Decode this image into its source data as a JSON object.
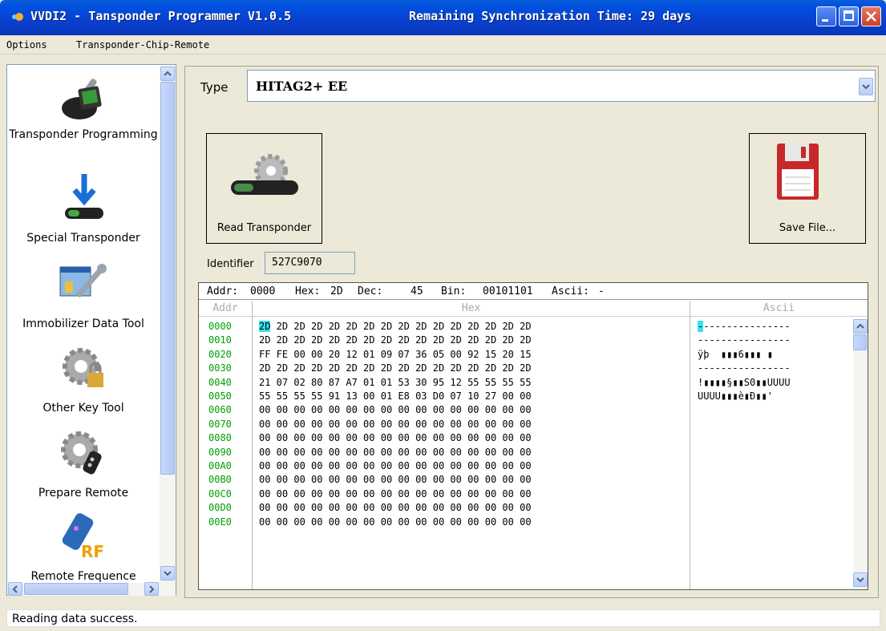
{
  "window": {
    "title": "VVDI2 - Tansponder Programmer V1.0.5",
    "sync": "Remaining Synchronization Time: 29 days"
  },
  "menu": [
    "Options",
    "Transponder-Chip-Remote"
  ],
  "sidebar": {
    "items": [
      {
        "label": "Transponder Programming",
        "icon": "key-reader-icon"
      },
      {
        "label": "Special Transponder",
        "icon": "download-arrow-icon"
      },
      {
        "label": "Immobilizer Data Tool",
        "icon": "wrench-window-icon"
      },
      {
        "label": "Other Key Tool",
        "icon": "gear-lock-icon"
      },
      {
        "label": "Prepare Remote",
        "icon": "gear-remote-icon"
      },
      {
        "label": "Remote Frequence",
        "icon": "rf-remote-icon"
      }
    ]
  },
  "type": {
    "label": "Type",
    "value": "HITAG2+ EE"
  },
  "buttons": {
    "read": "Read Transponder",
    "save": "Save File..."
  },
  "identifier": {
    "label": "Identifier",
    "value": "527C9070"
  },
  "hexview": {
    "status": {
      "addr_label": "Addr:",
      "addr": "0000",
      "hex_label": "Hex:",
      "hex": "2D",
      "dec_label": "Dec:",
      "dec": "45",
      "bin_label": "Bin:",
      "bin": "00101101",
      "ascii_label": "Ascii:",
      "ascii": "-"
    },
    "headers": {
      "addr": "Addr",
      "hex": "Hex",
      "ascii": "Ascii"
    },
    "rows": [
      {
        "addr": "0000",
        "hex": "2D 2D 2D 2D 2D 2D 2D 2D 2D 2D 2D 2D 2D 2D 2D 2D",
        "ascii": "----------------"
      },
      {
        "addr": "0010",
        "hex": "2D 2D 2D 2D 2D 2D 2D 2D 2D 2D 2D 2D 2D 2D 2D 2D",
        "ascii": "----------------"
      },
      {
        "addr": "0020",
        "hex": "FF FE 00 00 20 12 01 09 07 36 05 00 92 15 20 15",
        "ascii": "ÿþ  ▮▮▮6▮▮▮ ▮"
      },
      {
        "addr": "0030",
        "hex": "2D 2D 2D 2D 2D 2D 2D 2D 2D 2D 2D 2D 2D 2D 2D 2D",
        "ascii": "----------------"
      },
      {
        "addr": "0040",
        "hex": "21 07 02 80 87 A7 01 01 53 30 95 12 55 55 55 55",
        "ascii": "!▮▮▮▮§▮▮S0▮▮UUUU"
      },
      {
        "addr": "0050",
        "hex": "55 55 55 55 91 13 00 01 E8 03 D0 07 10 27 00 00",
        "ascii": "UUUU▮▮▮è▮Ð▮▮'"
      },
      {
        "addr": "0060",
        "hex": "00 00 00 00 00 00 00 00 00 00 00 00 00 00 00 00",
        "ascii": ""
      },
      {
        "addr": "0070",
        "hex": "00 00 00 00 00 00 00 00 00 00 00 00 00 00 00 00",
        "ascii": ""
      },
      {
        "addr": "0080",
        "hex": "00 00 00 00 00 00 00 00 00 00 00 00 00 00 00 00",
        "ascii": ""
      },
      {
        "addr": "0090",
        "hex": "00 00 00 00 00 00 00 00 00 00 00 00 00 00 00 00",
        "ascii": ""
      },
      {
        "addr": "00A0",
        "hex": "00 00 00 00 00 00 00 00 00 00 00 00 00 00 00 00",
        "ascii": ""
      },
      {
        "addr": "00B0",
        "hex": "00 00 00 00 00 00 00 00 00 00 00 00 00 00 00 00",
        "ascii": ""
      },
      {
        "addr": "00C0",
        "hex": "00 00 00 00 00 00 00 00 00 00 00 00 00 00 00 00",
        "ascii": ""
      },
      {
        "addr": "00D0",
        "hex": "00 00 00 00 00 00 00 00 00 00 00 00 00 00 00 00",
        "ascii": ""
      },
      {
        "addr": "00E0",
        "hex": "00 00 00 00 00 00 00 00 00 00 00 00 00 00 00 00",
        "ascii": ""
      }
    ]
  },
  "statusbar": "Reading data success.",
  "colors": {
    "addr": "#00a000",
    "selection": "#36e0ec",
    "titlebar": "#0052e0"
  }
}
